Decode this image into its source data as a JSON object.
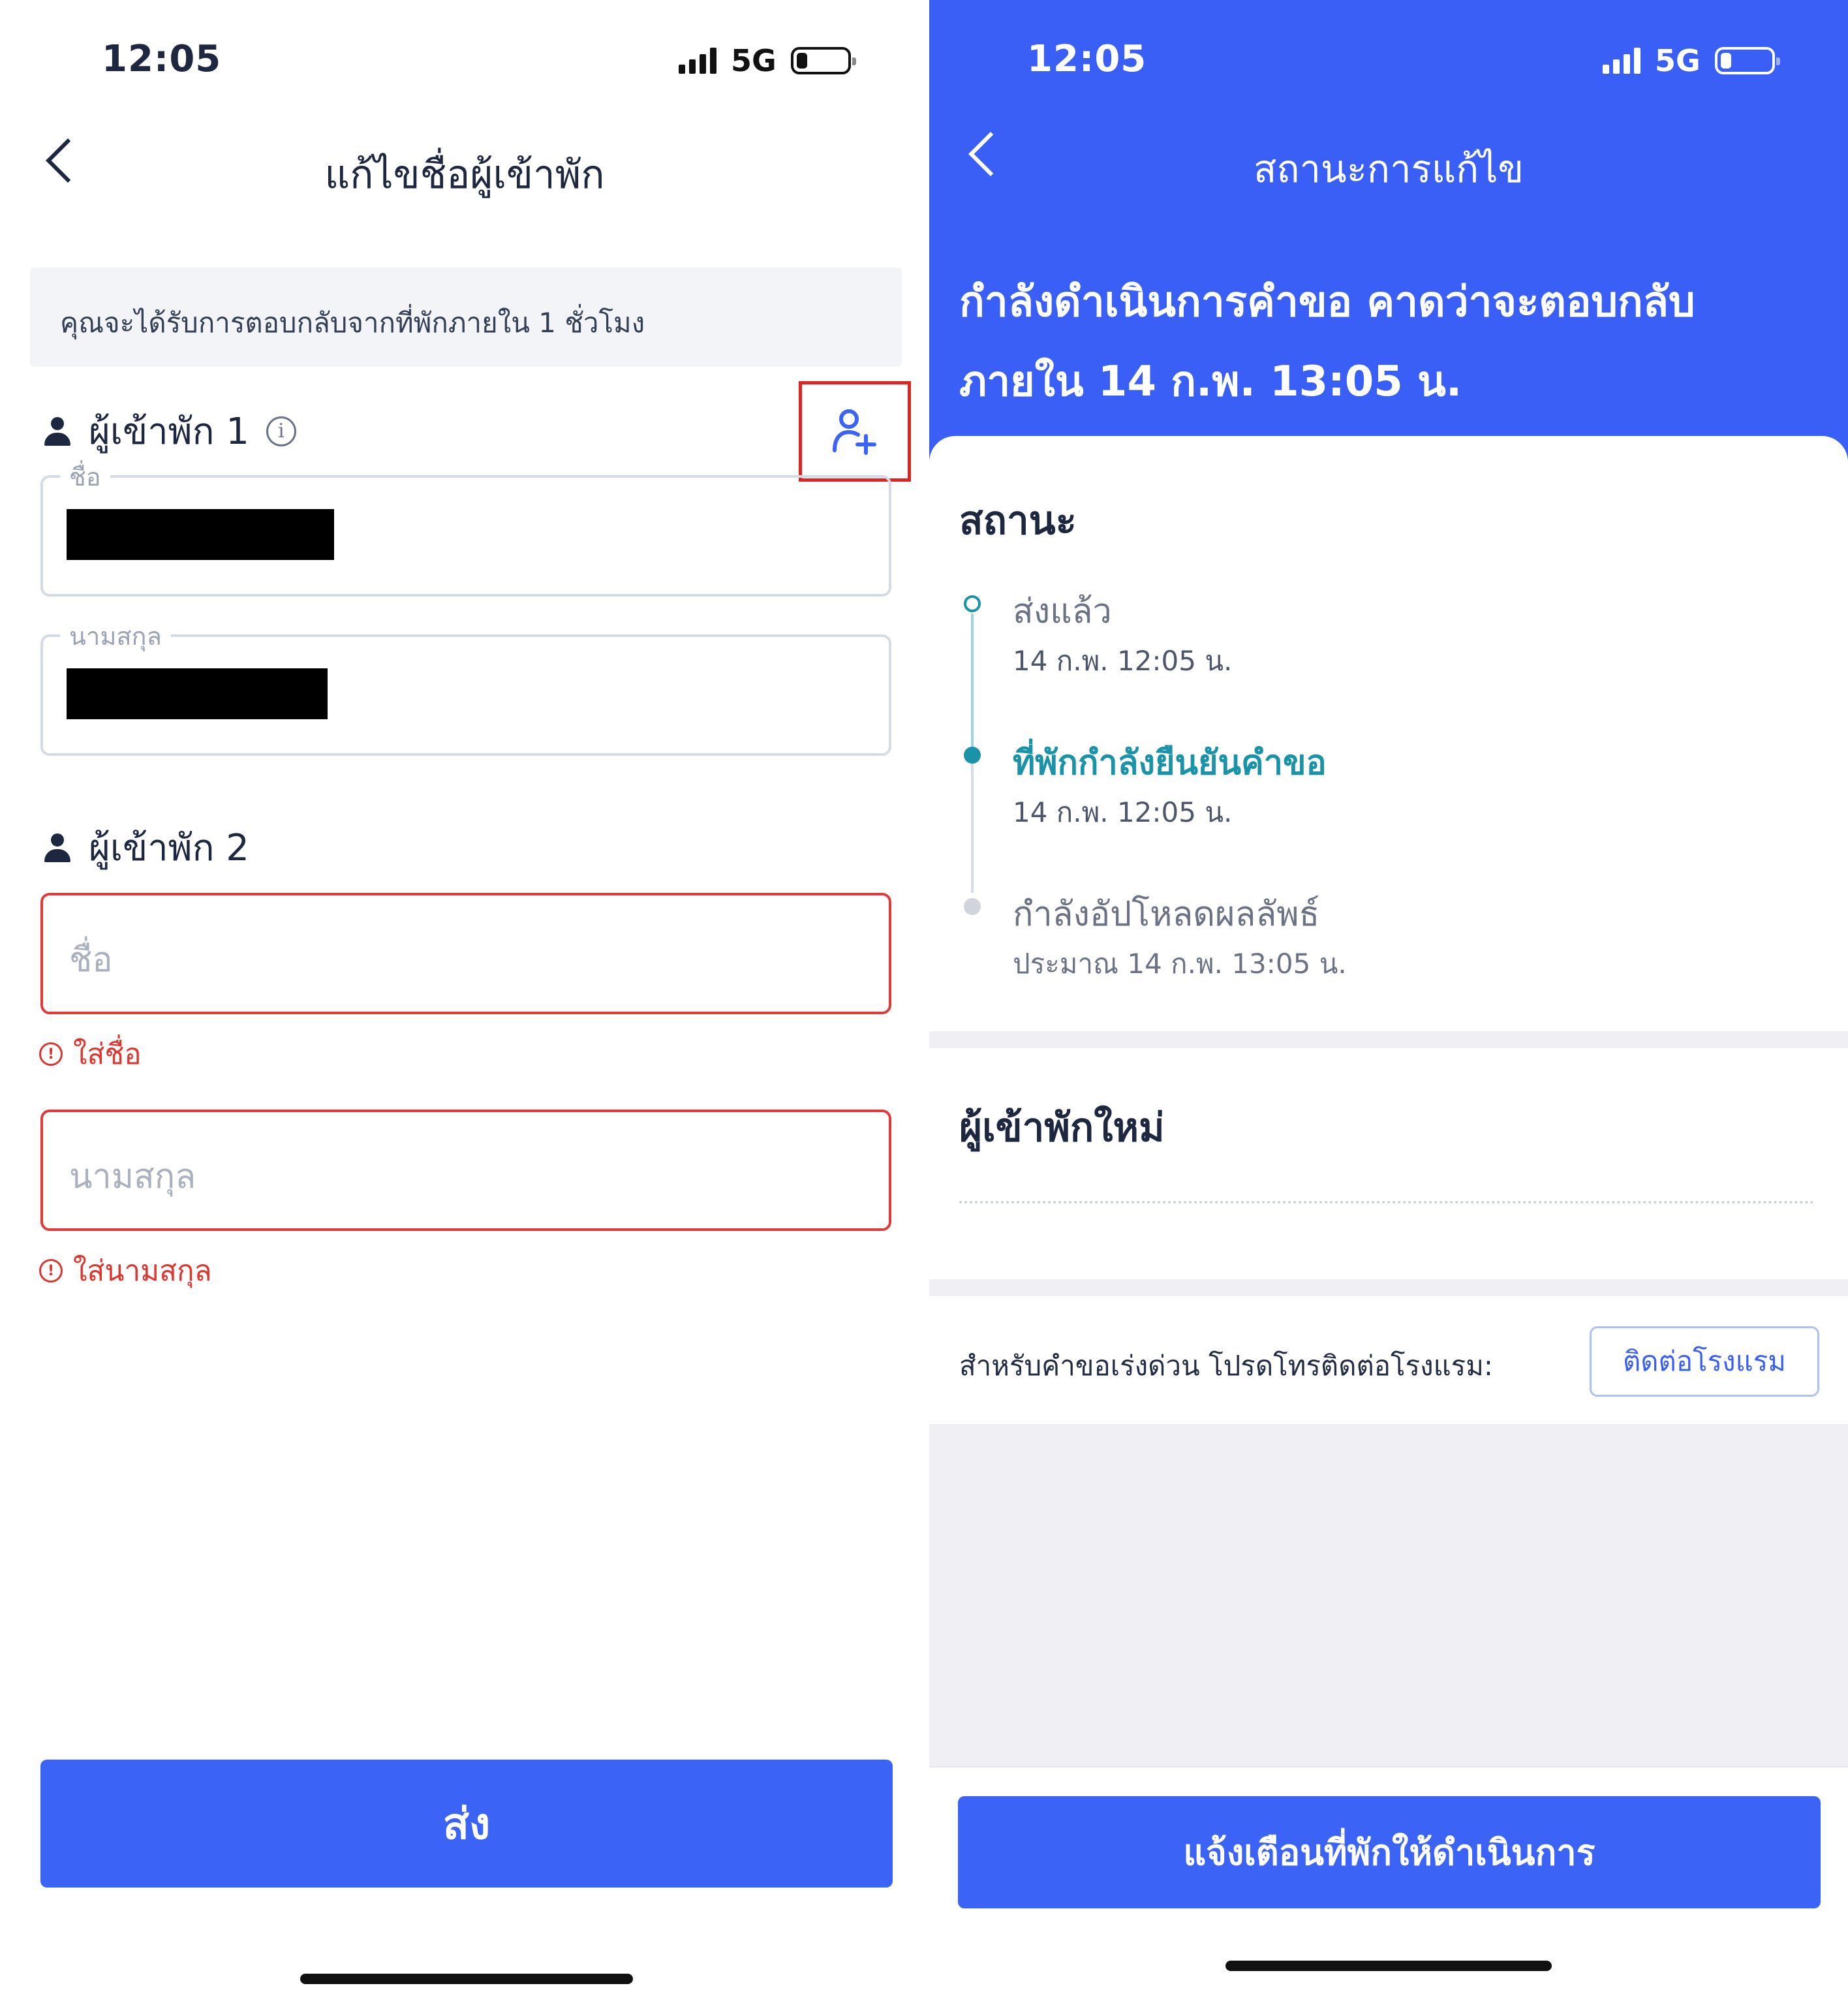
{
  "left_screen": {
    "status": {
      "time": "12:05",
      "network": "5G"
    },
    "nav_title": "แก้ไขชื่อผู้เข้าพัก",
    "notice": "คุณจะได้รับการตอบกลับจากที่พักภายใน 1 ชั่วโมง",
    "guest1": {
      "label": "ผู้เข้าพัก 1",
      "first_name_label": "ชื่อ",
      "last_name_label": "นามสกุล"
    },
    "guest2": {
      "label": "ผู้เข้าพัก 2",
      "first_name_placeholder": "ชื่อ",
      "first_name_error": "ใส่ชื่อ",
      "last_name_placeholder": "นามสกุล",
      "last_name_error": "ใส่นามสกุล"
    },
    "submit_label": "ส่ง",
    "icons": {
      "back": "back-chevron-icon",
      "person": "person-icon",
      "info": "info-icon",
      "add_guest": "add-person-icon",
      "error": "error-icon"
    }
  },
  "right_screen": {
    "status": {
      "time": "12:05",
      "network": "5G"
    },
    "nav_title": "สถานะการแก้ไข",
    "header_line1": "กำลังดำเนินการคำขอ คาดว่าจะตอบกลับ",
    "header_line2": "ภายใน 14 ก.พ. 13:05 น.",
    "status_section_title": "สถานะ",
    "steps": [
      {
        "title": "ส่งแล้ว",
        "time": "14 ก.พ. 12:05 น."
      },
      {
        "title": "ที่พักกำลังยืนยันคำขอ",
        "time": "14 ก.พ. 12:05 น."
      },
      {
        "title": "กำลังอัปโหลดผลลัพธ์",
        "time": "ประมาณ 14 ก.พ. 13:05 น."
      }
    ],
    "new_guests_title": "ผู้เข้าพักใหม่",
    "contact_text": "สำหรับคำขอเร่งด่วน โปรดโทรติดต่อโรงแรม:",
    "contact_button": "ติดต่อโรงแรม",
    "notify_button": "แจ้งเตือนที่พักให้ดำเนินการ"
  },
  "colors": {
    "primary": "#3b63f5",
    "header_blue": "#3a5ff7",
    "error": "#e0342f",
    "teal": "#1a93a8",
    "highlight_box": "#e02424"
  }
}
